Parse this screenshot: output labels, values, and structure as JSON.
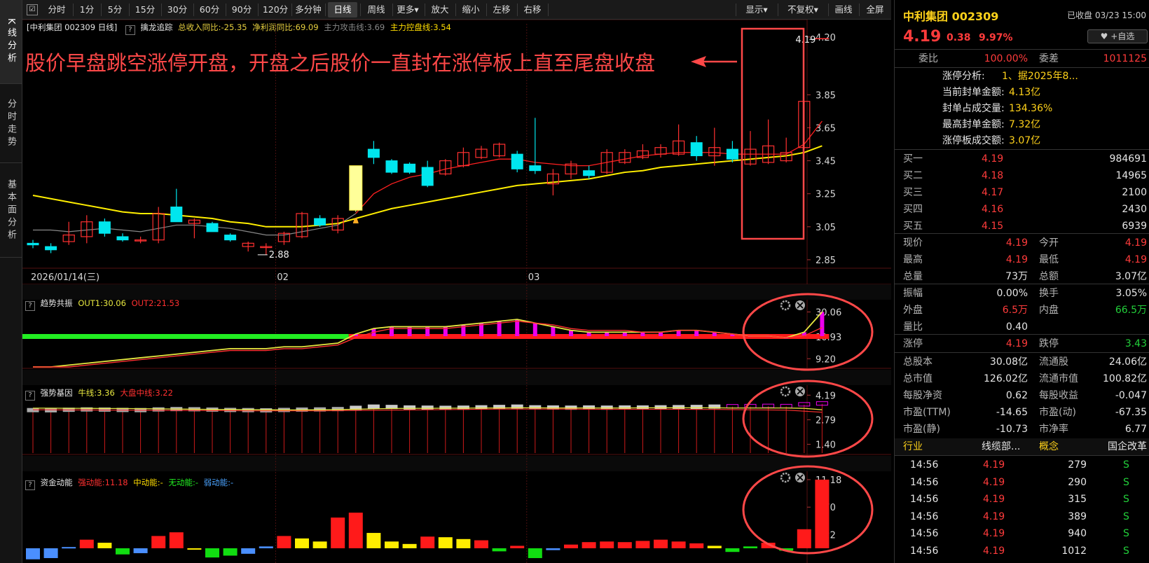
{
  "left_tabs": [
    {
      "label": "K线分析",
      "active": true
    },
    {
      "label": "分时走势",
      "active": false
    },
    {
      "label": "基本面分析",
      "active": false
    }
  ],
  "toolbar": {
    "periods": [
      "分时",
      "1分",
      "5分",
      "15分",
      "30分",
      "60分",
      "90分",
      "120分",
      "多分钟",
      "日线",
      "周线",
      "更多▾"
    ],
    "active_period": "日线",
    "tools": [
      "放大",
      "缩小",
      "左移",
      "右移"
    ],
    "right_tools": [
      "显示▾",
      "不复权▾",
      "画线",
      "全屏"
    ]
  },
  "main_legend": {
    "title": "[中利集团 002309 日线]",
    "indicator": "擒龙追踪",
    "items": [
      {
        "text": "总收入同比:-25.35",
        "color": "#e8d040"
      },
      {
        "text": "净利润同比:69.09",
        "color": "#e8d040"
      },
      {
        "text": "主力攻击线:3.69",
        "color": "#888888"
      },
      {
        "text": "主力控盘线:3.54",
        "color": "#ffdd00"
      }
    ]
  },
  "annotation": {
    "text": "股价早盘跳空涨停开盘，开盘之后股价一直封在涨停板上直至尾盘收盘",
    "color": "#ff3b3b"
  },
  "chart_data": [
    {
      "type": "candlestick",
      "panel": "main",
      "ylim": [
        2.82,
        4.28
      ],
      "y_ticks": [
        "4.20",
        "3.85",
        "3.65",
        "3.45",
        "3.25",
        "3.05",
        "2.85"
      ],
      "y_tick_values": [
        4.2,
        3.85,
        3.65,
        3.45,
        3.25,
        3.05,
        2.85
      ],
      "x_labels": [
        {
          "text": "2026/01/14(三)",
          "index": 0
        },
        {
          "text": "02",
          "index": 14
        },
        {
          "text": "03",
          "index": 28
        }
      ],
      "candles": [
        {
          "o": 2.95,
          "h": 2.97,
          "l": 2.92,
          "c": 2.94
        },
        {
          "o": 2.93,
          "h": 2.95,
          "l": 2.89,
          "c": 2.91
        },
        {
          "o": 2.96,
          "h": 3.08,
          "l": 2.94,
          "c": 3.0
        },
        {
          "o": 2.99,
          "h": 3.12,
          "l": 2.95,
          "c": 3.08
        },
        {
          "o": 3.08,
          "h": 3.1,
          "l": 2.99,
          "c": 3.01
        },
        {
          "o": 2.99,
          "h": 3.01,
          "l": 2.96,
          "c": 2.97
        },
        {
          "o": 2.97,
          "h": 2.99,
          "l": 2.95,
          "c": 2.97
        },
        {
          "o": 2.97,
          "h": 3.17,
          "l": 2.95,
          "c": 3.13
        },
        {
          "o": 3.17,
          "h": 3.28,
          "l": 3.09,
          "c": 3.08
        },
        {
          "o": 3.07,
          "h": 3.1,
          "l": 2.98,
          "c": 3.09
        },
        {
          "o": 3.07,
          "h": 3.08,
          "l": 3.02,
          "c": 3.02
        },
        {
          "o": 3.0,
          "h": 3.01,
          "l": 2.96,
          "c": 2.97
        },
        {
          "o": 2.93,
          "h": 2.96,
          "l": 2.9,
          "c": 2.95
        },
        {
          "o": 2.93,
          "h": 2.95,
          "l": 2.88,
          "c": 2.93
        },
        {
          "o": 2.96,
          "h": 3.02,
          "l": 2.94,
          "c": 3.01
        },
        {
          "o": 2.99,
          "h": 3.14,
          "l": 2.98,
          "c": 3.13
        },
        {
          "o": 3.1,
          "h": 3.12,
          "l": 3.05,
          "c": 3.06
        },
        {
          "o": 3.03,
          "h": 3.12,
          "l": 3.01,
          "c": 3.1
        },
        {
          "o": 3.15,
          "h": 3.42,
          "l": 3.14,
          "c": 3.42
        },
        {
          "o": 3.52,
          "h": 3.57,
          "l": 3.43,
          "c": 3.47
        },
        {
          "o": 3.45,
          "h": 3.46,
          "l": 3.37,
          "c": 3.38
        },
        {
          "o": 3.43,
          "h": 3.44,
          "l": 3.37,
          "c": 3.38
        },
        {
          "o": 3.41,
          "h": 3.45,
          "l": 3.29,
          "c": 3.3
        },
        {
          "o": 3.37,
          "h": 3.46,
          "l": 3.36,
          "c": 3.45
        },
        {
          "o": 3.42,
          "h": 3.53,
          "l": 3.41,
          "c": 3.5
        },
        {
          "o": 3.47,
          "h": 3.54,
          "l": 3.46,
          "c": 3.52
        },
        {
          "o": 3.48,
          "h": 3.56,
          "l": 3.47,
          "c": 3.55
        },
        {
          "o": 3.49,
          "h": 3.51,
          "l": 3.38,
          "c": 3.4
        },
        {
          "o": 3.42,
          "h": 3.71,
          "l": 3.37,
          "c": 3.39
        },
        {
          "o": 3.31,
          "h": 3.4,
          "l": 3.24,
          "c": 3.37
        },
        {
          "o": 3.37,
          "h": 3.45,
          "l": 3.34,
          "c": 3.43
        },
        {
          "o": 3.39,
          "h": 3.42,
          "l": 3.34,
          "c": 3.36
        },
        {
          "o": 3.38,
          "h": 3.52,
          "l": 3.37,
          "c": 3.5
        },
        {
          "o": 3.44,
          "h": 3.52,
          "l": 3.43,
          "c": 3.5
        },
        {
          "o": 3.47,
          "h": 3.55,
          "l": 3.46,
          "c": 3.51
        },
        {
          "o": 3.49,
          "h": 3.55,
          "l": 3.47,
          "c": 3.53
        },
        {
          "o": 3.49,
          "h": 3.67,
          "l": 3.48,
          "c": 3.57
        },
        {
          "o": 3.56,
          "h": 3.6,
          "l": 3.45,
          "c": 3.48
        },
        {
          "o": 3.48,
          "h": 3.65,
          "l": 3.42,
          "c": 3.53
        },
        {
          "o": 3.52,
          "h": 3.57,
          "l": 3.44,
          "c": 3.46
        },
        {
          "o": 3.43,
          "h": 3.63,
          "l": 3.42,
          "c": 3.52
        },
        {
          "o": 3.44,
          "h": 3.7,
          "l": 3.43,
          "c": 3.54
        },
        {
          "o": 3.45,
          "h": 3.59,
          "l": 3.44,
          "c": 3.5
        },
        {
          "o": 3.53,
          "h": 3.81,
          "l": 3.52,
          "c": 3.81
        },
        {
          "o": 4.19,
          "h": 4.19,
          "l": 4.19,
          "c": 4.19
        }
      ],
      "ma_gray": [
        3.03,
        3.03,
        3.02,
        3.03,
        3.04,
        3.03,
        3.02,
        3.04,
        3.06,
        3.06,
        3.05,
        3.04,
        3.02,
        3.0,
        3.0,
        3.02,
        3.04,
        3.06,
        3.13,
        3.25,
        3.31,
        3.35,
        3.37,
        3.4,
        3.42,
        3.44,
        3.46,
        3.46,
        3.44,
        3.43,
        3.42,
        3.42,
        3.44,
        3.46,
        3.48,
        3.49,
        3.5,
        3.5,
        3.5,
        3.49,
        3.49,
        3.49,
        3.49,
        3.55,
        3.69
      ],
      "ma_yellow": [
        3.24,
        3.22,
        3.2,
        3.18,
        3.16,
        3.14,
        3.13,
        3.13,
        3.12,
        3.11,
        3.1,
        3.08,
        3.07,
        3.05,
        3.05,
        3.05,
        3.06,
        3.07,
        3.1,
        3.13,
        3.16,
        3.18,
        3.2,
        3.22,
        3.24,
        3.26,
        3.28,
        3.3,
        3.31,
        3.32,
        3.33,
        3.34,
        3.36,
        3.38,
        3.39,
        3.41,
        3.42,
        3.43,
        3.44,
        3.45,
        3.46,
        3.47,
        3.48,
        3.5,
        3.54
      ],
      "high_label": "4.19",
      "low_label": "2.88"
    },
    {
      "type": "bar",
      "panel": "趋势共振",
      "title": "趋势共振",
      "legend": [
        {
          "name": "OUT1:30.06",
          "color": "#e8e840"
        },
        {
          "name": "OUT2:21.53",
          "color": "#ff3030"
        }
      ],
      "ylim": [
        0,
        36
      ],
      "y_ticks": [
        "30.06",
        "10.93",
        "9.20"
      ],
      "y_tick_values": [
        30.06,
        16.5,
        4.5
      ],
      "bars_from": 18,
      "values": [
        0,
        0,
        1,
        2,
        3,
        4,
        5,
        6,
        7,
        8,
        9,
        10,
        10,
        10,
        11,
        11,
        12,
        13,
        18,
        21,
        22,
        22,
        22,
        22,
        23,
        24,
        25,
        26,
        24,
        22,
        20,
        19,
        19,
        19,
        19,
        19,
        20,
        20,
        19,
        18,
        17,
        17,
        16,
        19,
        30.06
      ],
      "out1": [
        0,
        0,
        1,
        2,
        3,
        4,
        5,
        6,
        7,
        8,
        9,
        10,
        10,
        10,
        11,
        11,
        12,
        13,
        18,
        21,
        22,
        22,
        22,
        22,
        23,
        24,
        25,
        26,
        24,
        22,
        20,
        19,
        19,
        19,
        19,
        19,
        20,
        20,
        19,
        18,
        17,
        17,
        16,
        19,
        30.06
      ],
      "out2": [
        0,
        0,
        0,
        1,
        2,
        3,
        4,
        5,
        6,
        7,
        8,
        9,
        9,
        9,
        10,
        10,
        11,
        12,
        16,
        19,
        21,
        21,
        21,
        21,
        22,
        23,
        24,
        25,
        24,
        23,
        21,
        20,
        20,
        20,
        19,
        19,
        20,
        20,
        19,
        18,
        17,
        17,
        16,
        17,
        21.53
      ]
    },
    {
      "type": "bar",
      "panel": "强势基因",
      "title": "强势基因",
      "legend": [
        {
          "name": "牛线:3.36",
          "color": "#e8e840"
        },
        {
          "name": "大盘中线:3.22",
          "color": "#ff3030"
        }
      ],
      "ylim": [
        0.9,
        4.6
      ],
      "y_ticks": [
        "4.19",
        "2.79",
        "1.40"
      ],
      "y_tick_values": [
        4.19,
        2.79,
        1.4
      ],
      "values": [
        3.32,
        3.31,
        3.34,
        3.36,
        3.35,
        3.33,
        3.32,
        3.36,
        3.38,
        3.37,
        3.35,
        3.33,
        3.32,
        3.31,
        3.33,
        3.35,
        3.36,
        3.38,
        3.45,
        3.52,
        3.5,
        3.47,
        3.46,
        3.45,
        3.46,
        3.48,
        3.5,
        3.52,
        3.48,
        3.47,
        3.46,
        3.47,
        3.46,
        3.47,
        3.47,
        3.48,
        3.49,
        3.5,
        3.52,
        3.54,
        3.55,
        3.56,
        3.55,
        3.65,
        3.7
      ],
      "niu": [
        3.45,
        3.45,
        3.44,
        3.44,
        3.43,
        3.43,
        3.42,
        3.41,
        3.4,
        3.39,
        3.38,
        3.38,
        3.37,
        3.36,
        3.35,
        3.35,
        3.36,
        3.37,
        3.39,
        3.41,
        3.43,
        3.44,
        3.44,
        3.45,
        3.45,
        3.46,
        3.46,
        3.47,
        3.47,
        3.46,
        3.46,
        3.46,
        3.46,
        3.46,
        3.47,
        3.47,
        3.47,
        3.47,
        3.47,
        3.46,
        3.46,
        3.46,
        3.46,
        3.44,
        3.36
      ],
      "dapan": [
        3.36,
        3.36,
        3.35,
        3.35,
        3.34,
        3.34,
        3.33,
        3.33,
        3.32,
        3.32,
        3.31,
        3.31,
        3.3,
        3.3,
        3.3,
        3.3,
        3.3,
        3.31,
        3.32,
        3.33,
        3.34,
        3.35,
        3.36,
        3.37,
        3.38,
        3.39,
        3.4,
        3.4,
        3.4,
        3.4,
        3.4,
        3.39,
        3.39,
        3.39,
        3.39,
        3.39,
        3.39,
        3.38,
        3.38,
        3.37,
        3.36,
        3.35,
        3.34,
        3.28,
        3.22
      ]
    },
    {
      "type": "bar",
      "panel": "资金动能",
      "title": "资金动能",
      "legend": [
        {
          "name": "强动能:11.18",
          "color": "#ff3030"
        },
        {
          "name": "中动能:-",
          "color": "#ffdd00"
        },
        {
          "name": "无动能:-",
          "color": "#22ee22"
        },
        {
          "name": "弱动能:-",
          "color": "#4aa3ff"
        }
      ],
      "ylim": [
        -2.4,
        12.2
      ],
      "y_ticks": [
        "11.18",
        "6.70",
        "2.22"
      ],
      "y_tick_values": [
        11.18,
        6.7,
        2.22
      ],
      "values": [
        -1.8,
        -1.6,
        0.2,
        1.4,
        0.9,
        -1.0,
        -0.8,
        2.0,
        2.6,
        -0.1,
        -1.5,
        -1.2,
        -0.9,
        0.3,
        2.0,
        1.6,
        1.1,
        5.0,
        5.8,
        2.5,
        1.1,
        0.7,
        1.9,
        1.8,
        1.5,
        1.3,
        -0.5,
        0.4,
        -1.6,
        -0.3,
        0.6,
        1.0,
        1.1,
        1.0,
        1.2,
        1.4,
        1.1,
        0.8,
        0.4,
        -0.6,
        0.3,
        0.9,
        -0.4,
        3.1,
        11.18
      ],
      "colors": [
        "blue",
        "blue",
        "blue",
        "red",
        "yellow",
        "green",
        "blue",
        "red",
        "red",
        "yellow",
        "green",
        "green",
        "blue",
        "blue",
        "red",
        "yellow",
        "yellow",
        "red",
        "red",
        "yellow",
        "yellow",
        "yellow",
        "red",
        "yellow",
        "yellow",
        "red",
        "green",
        "red",
        "green",
        "blue",
        "red",
        "red",
        "red",
        "red",
        "red",
        "red",
        "red",
        "red",
        "yellow",
        "green",
        "green",
        "red",
        "green",
        "red",
        "red"
      ]
    }
  ],
  "stock": {
    "name": "中利集团 002309",
    "status": "已收盘",
    "time": "03/23 15:00",
    "price": "4.19",
    "change": "0.38",
    "pct": "9.97%",
    "watch": "+自选"
  },
  "weibi": {
    "label1": "委比",
    "val1": "100.00%",
    "label2": "委差",
    "val2": "1011125"
  },
  "limit_info": [
    {
      "label": "涨停分析:",
      "value": "1、据2025年8..."
    },
    {
      "label": "当前封单金额:",
      "value": "4.13亿"
    },
    {
      "label": "封单占成交量:",
      "value": "134.36%"
    },
    {
      "label": "最高封单金额:",
      "value": "7.32亿"
    },
    {
      "label": "涨停板成交额:",
      "value": "3.07亿"
    }
  ],
  "bids": [
    {
      "label": "买一",
      "price": "4.19",
      "vol": "984691"
    },
    {
      "label": "买二",
      "price": "4.18",
      "vol": "14965"
    },
    {
      "label": "买三",
      "price": "4.17",
      "vol": "2100"
    },
    {
      "label": "买四",
      "price": "4.16",
      "vol": "2430"
    },
    {
      "label": "买五",
      "price": "4.15",
      "vol": "6939"
    }
  ],
  "quote": [
    {
      "l1": "现价",
      "v1": "4.19",
      "c1": "red",
      "l2": "今开",
      "v2": "4.19",
      "c2": "red"
    },
    {
      "l1": "最高",
      "v1": "4.19",
      "c1": "red",
      "l2": "最低",
      "v2": "4.19",
      "c2": "red"
    },
    {
      "l1": "总量",
      "v1": "73万",
      "c1": "white",
      "l2": "总额",
      "v2": "3.07亿",
      "c2": "white"
    }
  ],
  "quote2": [
    {
      "l1": "振幅",
      "v1": "0.00%",
      "c1": "white",
      "l2": "换手",
      "v2": "3.05%",
      "c2": "white"
    },
    {
      "l1": "外盘",
      "v1": "6.5万",
      "c1": "red",
      "l2": "内盘",
      "v2": "66.5万",
      "c2": "green"
    },
    {
      "l1": "量比",
      "v1": "0.40",
      "c1": "white",
      "l2": "",
      "v2": "",
      "c2": "white"
    }
  ],
  "quote3": [
    {
      "l1": "涨停",
      "v1": "4.19",
      "c1": "red",
      "l2": "跌停",
      "v2": "3.43",
      "c2": "green"
    }
  ],
  "fundamentals": [
    {
      "l1": "总股本",
      "v1": "30.08亿",
      "l2": "流通股",
      "v2": "24.06亿"
    },
    {
      "l1": "总市值",
      "v1": "126.02亿",
      "l2": "流通市值",
      "v2": "100.82亿"
    },
    {
      "l1": "每股净资",
      "v1": "0.62",
      "l2": "每股收益",
      "v2": "-0.047"
    },
    {
      "l1": "市盈(TTM)",
      "v1": "-14.65",
      "l2": "市盈(动)",
      "v2": "-67.35"
    },
    {
      "l1": "市盈(静)",
      "v1": "-10.73",
      "l2": "市净率",
      "v2": "6.77"
    }
  ],
  "industry": {
    "l1": "行业",
    "v1": "线缆部...",
    "l2": "概念",
    "v2": "国企改革"
  },
  "ticks": [
    {
      "time": "14:56",
      "price": "4.19",
      "vol": "279",
      "flag": "S"
    },
    {
      "time": "14:56",
      "price": "4.19",
      "vol": "290",
      "flag": "S"
    },
    {
      "time": "14:56",
      "price": "4.19",
      "vol": "315",
      "flag": "S"
    },
    {
      "time": "14:56",
      "price": "4.19",
      "vol": "389",
      "flag": "S"
    },
    {
      "time": "14:56",
      "price": "4.19",
      "vol": "940",
      "flag": "S"
    },
    {
      "time": "14:56",
      "price": "4.19",
      "vol": "1012",
      "flag": "S"
    }
  ],
  "colors": {
    "up": "#ff3030",
    "down": "#00e6ee",
    "ma_yellow": "#ffee00",
    "ma_gray": "#888888",
    "annotation": "#ff4848",
    "grid": "#3a0a0a"
  }
}
